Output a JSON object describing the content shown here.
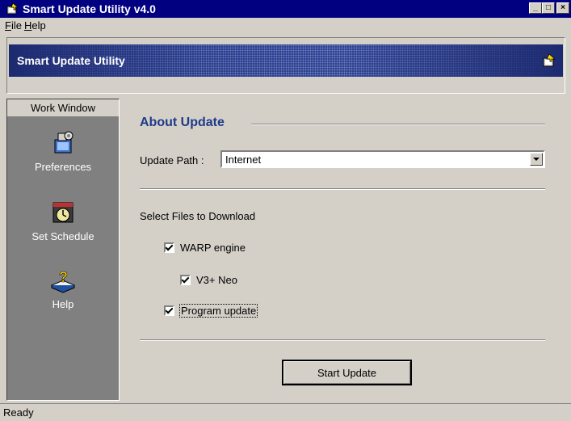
{
  "window": {
    "title": "Smart Update Utility v4.0",
    "controls": {
      "minimize": "_",
      "maximize": "□",
      "close": "×"
    }
  },
  "menu": {
    "file": "File",
    "help": "Help"
  },
  "banner": {
    "title": "Smart Update Utility"
  },
  "sidebar": {
    "header": "Work Window",
    "items": [
      {
        "label": "Preferences",
        "icon": "preferences-icon"
      },
      {
        "label": "Set Schedule",
        "icon": "schedule-clock-icon"
      },
      {
        "label": "Help",
        "icon": "help-book-icon"
      }
    ]
  },
  "main": {
    "section_title": "About Update",
    "update_path_label": "Update Path :",
    "update_path_value": "Internet",
    "files_label": "Select Files to Download",
    "checkboxes": [
      {
        "label": "WARP engine",
        "checked": true
      },
      {
        "label": "V3+ Neo",
        "checked": true
      },
      {
        "label": "Program update",
        "checked": true
      }
    ],
    "start_button": "Start Update"
  },
  "status": {
    "text": "Ready"
  },
  "colors": {
    "titlebar": "#000080",
    "section_title": "#1e3a8a",
    "sidebar_bg": "#808080",
    "face": "#d4d0c8"
  }
}
